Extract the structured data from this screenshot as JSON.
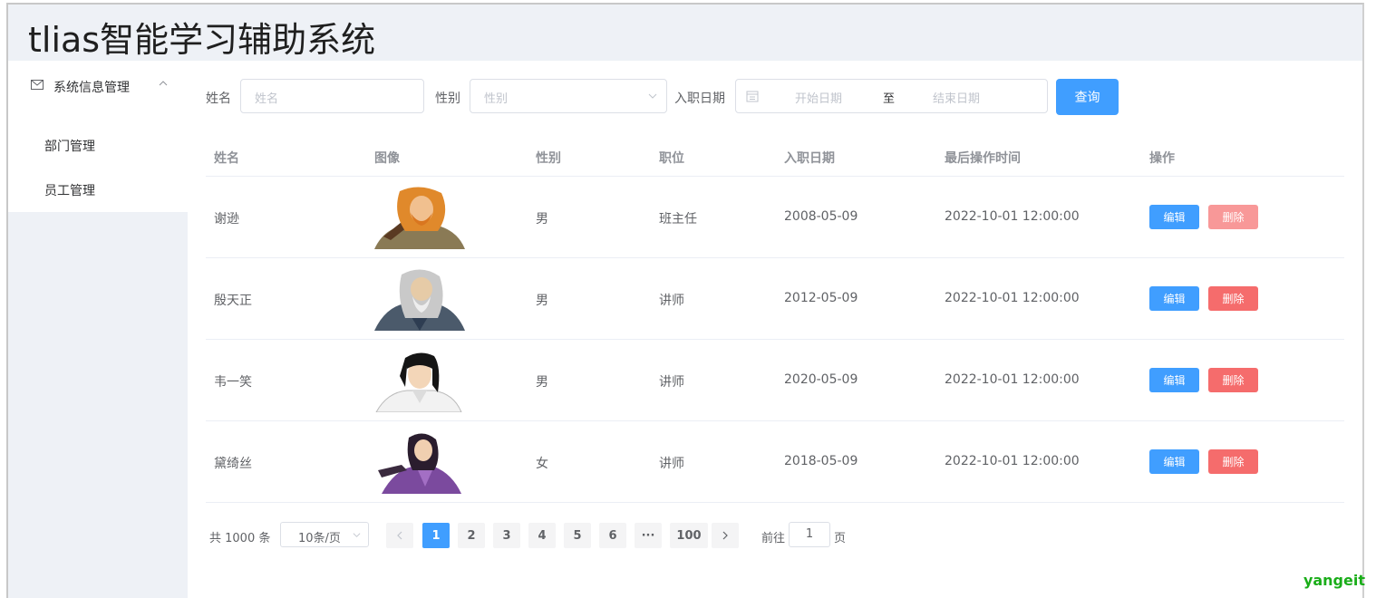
{
  "app": {
    "title": "tlias智能学习辅助系统"
  },
  "sidebar": {
    "group_label": "系统信息管理",
    "items": [
      {
        "label": "部门管理"
      },
      {
        "label": "员工管理"
      }
    ]
  },
  "search": {
    "name_label": "姓名",
    "name_placeholder": "姓名",
    "gender_label": "性别",
    "gender_placeholder": "性别",
    "date_label": "入职日期",
    "start_placeholder": "开始日期",
    "range_separator": "至",
    "end_placeholder": "结束日期",
    "query_label": "查询"
  },
  "table": {
    "headers": [
      "姓名",
      "图像",
      "性别",
      "职位",
      "入职日期",
      "最后操作时间",
      "操作"
    ],
    "rows": [
      {
        "name": "谢逊",
        "avatar": "orange-haired-warrior-avatar",
        "gender": "男",
        "job": "班主任",
        "entry_date": "2008-05-09",
        "update_time": "2022-10-01 12:00:00"
      },
      {
        "name": "殷天正",
        "avatar": "gray-haired-elder-avatar",
        "gender": "男",
        "job": "讲师",
        "entry_date": "2012-05-09",
        "update_time": "2022-10-01 12:00:00"
      },
      {
        "name": "韦一笑",
        "avatar": "black-haired-swordsman-avatar",
        "gender": "男",
        "job": "讲师",
        "entry_date": "2020-05-09",
        "update_time": "2022-10-01 12:00:00"
      },
      {
        "name": "黛绮丝",
        "avatar": "purple-robed-woman-avatar",
        "gender": "女",
        "job": "讲师",
        "entry_date": "2018-05-09",
        "update_time": "2022-10-01 12:00:00"
      }
    ],
    "edit_label": "编辑",
    "delete_label": "删除"
  },
  "pagination": {
    "total_text": "共 1000 条",
    "page_size": "10条/页",
    "pages": [
      "1",
      "2",
      "3",
      "4",
      "5",
      "6",
      "···",
      "100"
    ],
    "current": "1",
    "prev_icon": "chevron-left-icon",
    "next_icon": "chevron-right-icon",
    "goto_label": "前往",
    "goto_value": "1",
    "page_suffix": "页"
  },
  "watermark": "yangeit",
  "colors": {
    "primary": "#409eff",
    "danger": "#f56c6c",
    "header_bg": "#eef1f6"
  }
}
